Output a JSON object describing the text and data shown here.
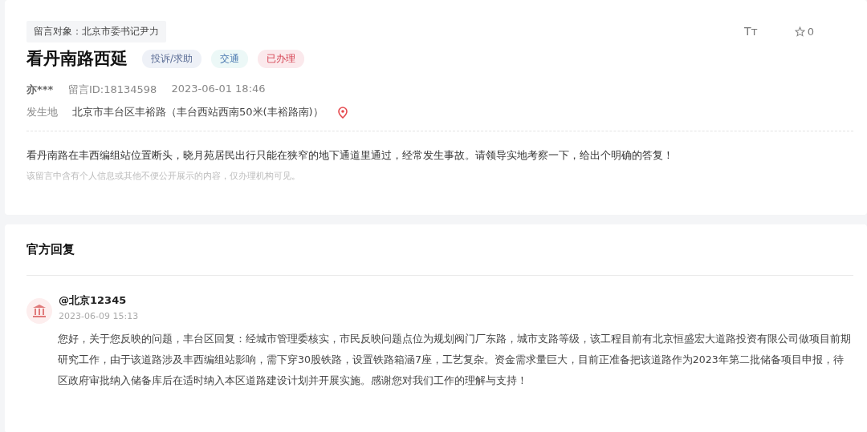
{
  "message": {
    "recipient": "留言对象：北京市委书记尹力",
    "title": "看丹南路西延",
    "tags": [
      {
        "label": "投诉/求助",
        "kind": "type"
      },
      {
        "label": "交通",
        "kind": "category"
      },
      {
        "label": "已办理",
        "kind": "status"
      }
    ],
    "author": "亦***",
    "message_id": "留言ID:18134598",
    "time": "2023-06-01 18:46",
    "location_label": "发生地",
    "location": "北京市丰台区丰裕路（丰台西站西南50米(丰裕路南)）",
    "body": "看丹南路在丰西编组站位置断头，晓月苑居民出行只能在狭窄的地下通道里通过，经常发生事故。请领导实地考察一下，给出个明确的答复！",
    "privacy_note": "该留言中含有个人信息或其他不便公开展示的内容，仅办理机构可见。",
    "font_size_button": "Tт",
    "favorites": "0"
  },
  "reply": {
    "heading": "官方回复",
    "name": "@北京12345",
    "time": "2023-06-09 15:13",
    "text": "您好，关于您反映的问题，丰台区回复：经城市管理委核实，市民反映问题点位为规划阀门厂东路，城市支路等级，该工程目前有北京恒盛宏大道路投资有限公司做项目前期研究工作，由于该道路涉及丰西编组站影响，需下穿30股铁路，设置铁路箱涵7座，工艺复杂。资金需求量巨大，目前正准备把该道路作为2023年第二批储备项目申报，待区政府审批纳入储备库后在适时纳入本区道路建设计划并开展实施。感谢您对我们工作的理解与支持！"
  }
}
